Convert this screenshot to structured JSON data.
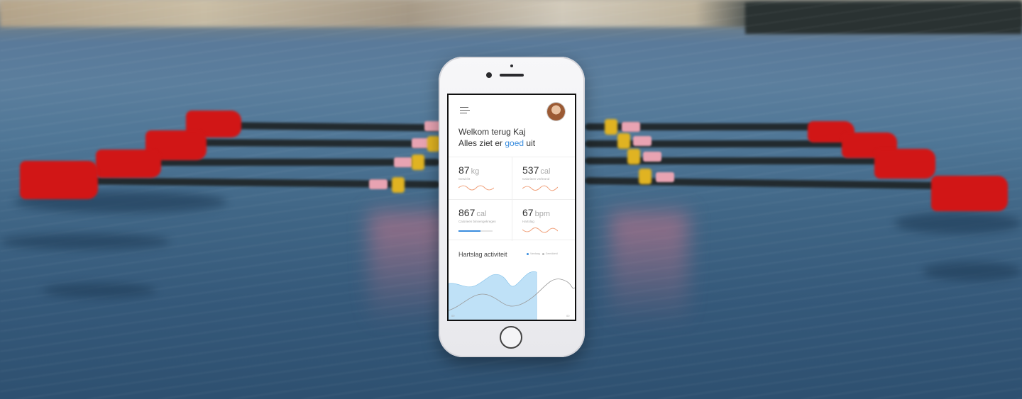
{
  "app": {
    "greeting_line1": "Welkom terug Kaj",
    "greeting_line2_prefix": "Alles ziet er ",
    "greeting_line2_accent": "goed",
    "greeting_line2_suffix": " uit"
  },
  "icons": {
    "menu": "hamburger-menu-icon",
    "profile": "user-avatar"
  },
  "stats": [
    {
      "value": "87",
      "unit": "kg",
      "label": "Gewicht",
      "indicator": "sparkline"
    },
    {
      "value": "537",
      "unit": "cal",
      "label": "Calorieen verbrand",
      "indicator": "sparkline"
    },
    {
      "value": "867",
      "unit": "cal",
      "label": "Calorieen binnengekregen",
      "indicator": "progress",
      "progress": 0.65
    },
    {
      "value": "67",
      "unit": "bpm",
      "label": "Hartslag",
      "indicator": "sparkline"
    }
  ],
  "activity": {
    "title": "Hartslag activiteit",
    "legend": [
      "Vandaag",
      "Gemiddeld"
    ],
    "axis_start": "00",
    "axis_end": "00"
  },
  "colors": {
    "accent": "#3a8dde",
    "sparkline": "#f0a07a",
    "area_fill": "#bfe1f7",
    "average_line": "#9a9a9a"
  }
}
